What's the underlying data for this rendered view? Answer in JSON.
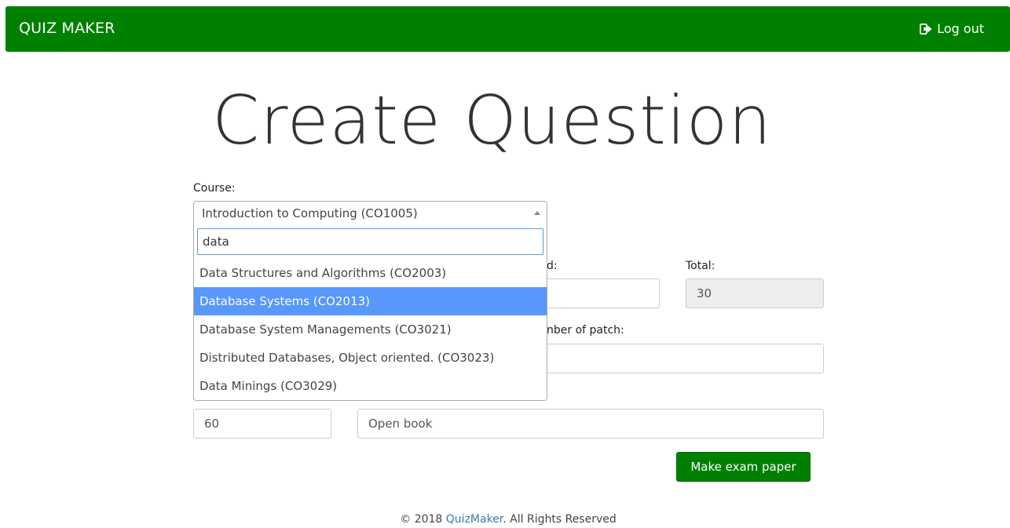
{
  "navbar": {
    "brand": "QUIZ MAKER",
    "logout_label": "Log out",
    "logout_icon": "sign-out-icon",
    "color": "#008000"
  },
  "page": {
    "title": "Create Question"
  },
  "form": {
    "course_label": "Course:",
    "course_selected": "Introduction to Computing (CO1005)",
    "course_search_value": "data",
    "course_options": [
      "Data Structures and Algorithms (CO2003)",
      "Database Systems (CO2013)",
      "Database System Managements (CO3021)",
      "Distributed Databases, Object oriented. (CO3023)",
      "Data Minings (CO3029)"
    ],
    "highlighted_option_index": 1,
    "partial_label_1": "d:",
    "total_label": "Total:",
    "total_value": "30",
    "partial_label_2": "nber of patch:",
    "time_value": "60",
    "note_value": "Open book",
    "submit_label": "Make exam paper"
  },
  "footer": {
    "prefix": "© 2018 ",
    "link": "QuizMaker",
    "suffix": ". All Rights Reserved"
  }
}
